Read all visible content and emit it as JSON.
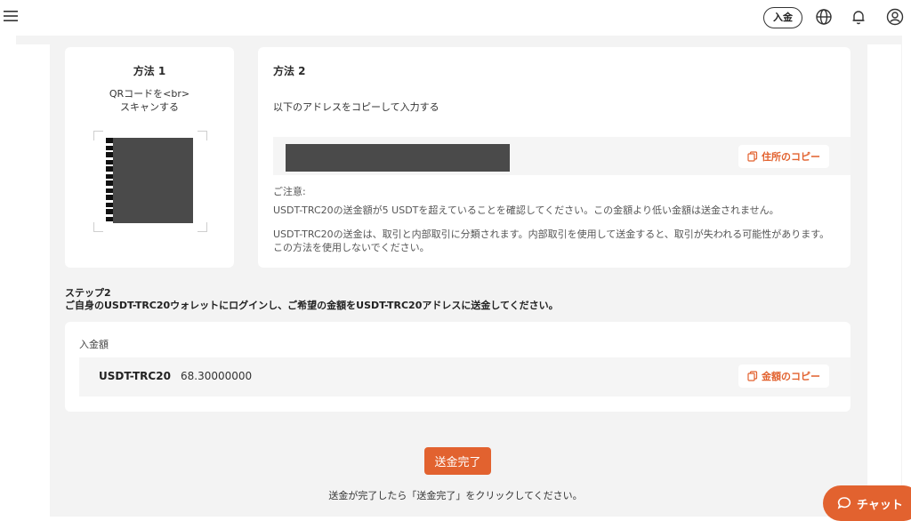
{
  "header": {
    "deposit_button_label": "入金",
    "icons": [
      "menu-icon",
      "globe-icon",
      "bell-icon",
      "user-icon"
    ]
  },
  "method1": {
    "title": "方法 1",
    "description_line1": "QRコードを<br>",
    "description_line2": "スキャンする"
  },
  "method2": {
    "title": "方法 2",
    "instruction": "以下のアドレスをコピーして入力する",
    "copy_address_label": "住所のコピー",
    "notice_label": "ご注意:",
    "notice_line1": "USDT-TRC20の送金額が5 USDTを超えていることを確認してください。この金額より低い金額は送金されません。",
    "notice_line2": "USDT-TRC20の送金は、取引と内部取引に分類されます。内部取引を使用して送金すると、取引が失われる可能性があります。この方法を使用しないでください。"
  },
  "step2": {
    "title": "ステップ2",
    "description": "ご自身のUSDT-TRC20ウォレットにログインし、ご希望の金額をUSDT-TRC20アドレスに送金してください。",
    "amount_label": "入金額",
    "currency": "USDT-TRC20",
    "amount": "68.30000000",
    "copy_amount_label": "金額のコピー"
  },
  "actions": {
    "done_button_label": "送金完了",
    "done_note": "送金が完了したら「送金完了」をクリックしてください。"
  },
  "chat": {
    "label": "チャット"
  },
  "colors": {
    "accent": "#e2622f",
    "page_bg": "#f3f3f3",
    "card_bg": "#ffffff",
    "masked": "#4a4a4a"
  }
}
